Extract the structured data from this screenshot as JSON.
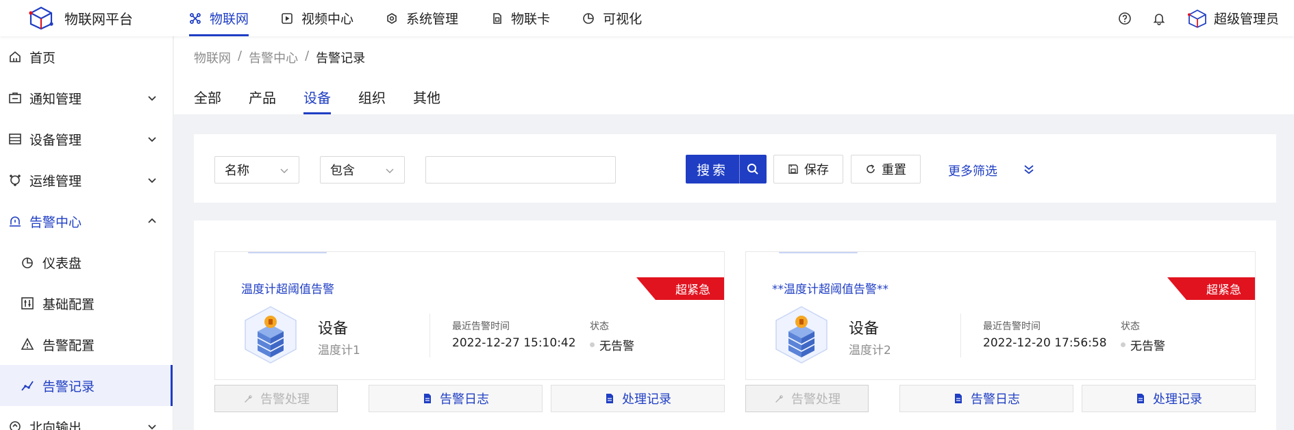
{
  "app": {
    "title": "物联网平台"
  },
  "topnav": [
    {
      "label": "物联网",
      "icon": "iot-icon",
      "active": true
    },
    {
      "label": "视频中心",
      "icon": "video-icon"
    },
    {
      "label": "系统管理",
      "icon": "settings-icon"
    },
    {
      "label": "物联卡",
      "icon": "sim-card-icon"
    },
    {
      "label": "可视化",
      "icon": "pie-chart-icon"
    }
  ],
  "header_right": {
    "help_icon": "help-icon",
    "bell_icon": "bell-icon",
    "user_name": "超级管理员"
  },
  "sidebar": [
    {
      "label": "首页",
      "icon": "home-icon"
    },
    {
      "label": "通知管理",
      "icon": "notice-icon",
      "expandable": true
    },
    {
      "label": "设备管理",
      "icon": "device-icon",
      "expandable": true
    },
    {
      "label": "运维管理",
      "icon": "ops-icon",
      "expandable": true
    },
    {
      "label": "告警中心",
      "icon": "alarm-icon",
      "expandable": true,
      "open": true
    },
    {
      "label": "仪表盘",
      "icon": "dashboard-icon",
      "sub": true
    },
    {
      "label": "基础配置",
      "icon": "config-icon",
      "sub": true
    },
    {
      "label": "告警配置",
      "icon": "warning-icon",
      "sub": true
    },
    {
      "label": "告警记录",
      "icon": "record-icon",
      "sub": true,
      "selected": true
    },
    {
      "label": "北向输出",
      "icon": "output-icon",
      "expandable": true
    }
  ],
  "breadcrumb": [
    "物联网",
    "告警中心",
    "告警记录"
  ],
  "tabs": [
    {
      "label": "全部"
    },
    {
      "label": "产品"
    },
    {
      "label": "设备",
      "active": true
    },
    {
      "label": "组织"
    },
    {
      "label": "其他"
    }
  ],
  "filter": {
    "field_select": "名称",
    "operator_select": "包含",
    "value": "",
    "search_label": "搜索",
    "save_label": "保存",
    "reset_label": "重置",
    "more_label": "更多筛选"
  },
  "cards": [
    {
      "title": "温度计超阈值告警",
      "level": "超紧急",
      "type": "设备",
      "device": "温度计1",
      "time_label": "最近告警时间",
      "time": "2022-12-27 15:10:42",
      "status_label": "状态",
      "status": "无告警",
      "actions": [
        "告警处理",
        "告警日志",
        "处理记录"
      ]
    },
    {
      "title": "**温度计超阈值告警**",
      "level": "超紧急",
      "type": "设备",
      "device": "温度计2",
      "time_label": "最近告警时间",
      "time": "2022-12-20 17:56:58",
      "status_label": "状态",
      "status": "无告警",
      "actions": [
        "告警处理",
        "告警日志",
        "处理记录"
      ]
    }
  ],
  "colors": {
    "accent": "#1f3ec4",
    "danger": "#e1131f",
    "sidebar_selected_bg": "#eef0fb"
  }
}
